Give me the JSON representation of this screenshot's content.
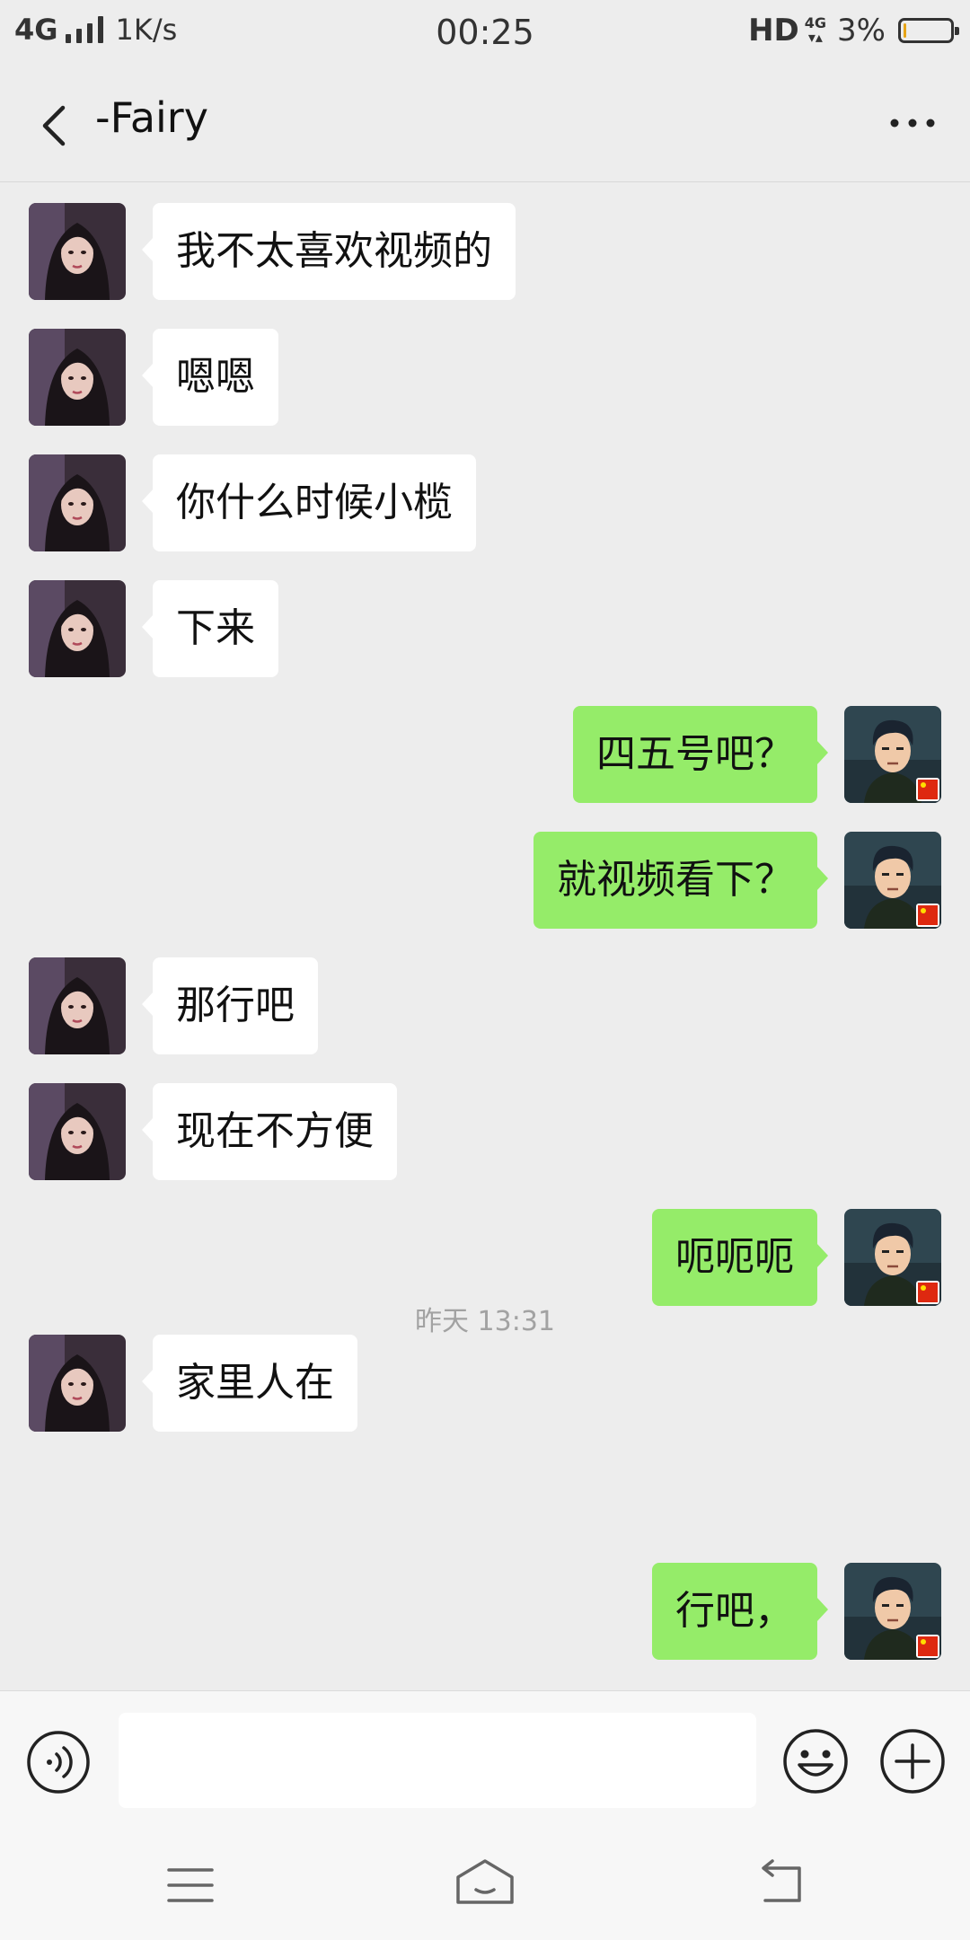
{
  "status_bar": {
    "network": "4G",
    "speed": "1K/s",
    "time": "00:25",
    "hd": "HD",
    "network2": "4G",
    "battery_percent": "3%",
    "battery_level": 0.06,
    "battery_color": "#e6a417"
  },
  "header": {
    "title": "-Fairy",
    "back_icon": "chevron-left-icon",
    "more_icon": "more-dots-icon"
  },
  "messages": [
    {
      "side": "in",
      "text": "我不太喜欢视频的"
    },
    {
      "side": "in",
      "text": "嗯嗯"
    },
    {
      "side": "in",
      "text": "你什么时候小榄"
    },
    {
      "side": "in",
      "text": "下来"
    },
    {
      "side": "out",
      "text": "四五号吧？"
    },
    {
      "side": "out",
      "text": "就视频看下？"
    },
    {
      "side": "in",
      "text": "那行吧"
    },
    {
      "side": "in",
      "text": "现在不方便"
    },
    {
      "side": "out",
      "text": "呃呃呃"
    },
    {
      "side": "in",
      "text": "家里人在"
    },
    {
      "side": "out",
      "text": "行吧，"
    }
  ],
  "timestamp": "昨天 13:31",
  "input_bar": {
    "voice_icon": "voice-icon",
    "input_value": "",
    "emoji_icon": "emoji-icon",
    "plus_icon": "plus-icon"
  },
  "nav_bar": {
    "menu_icon": "menu-icon",
    "home_icon": "home-icon",
    "back_icon": "back-icon"
  },
  "colors": {
    "background": "#ededed",
    "incoming_bubble": "#ffffff",
    "outgoing_bubble": "#95ec69",
    "timestamp": "#a2a2a2"
  }
}
